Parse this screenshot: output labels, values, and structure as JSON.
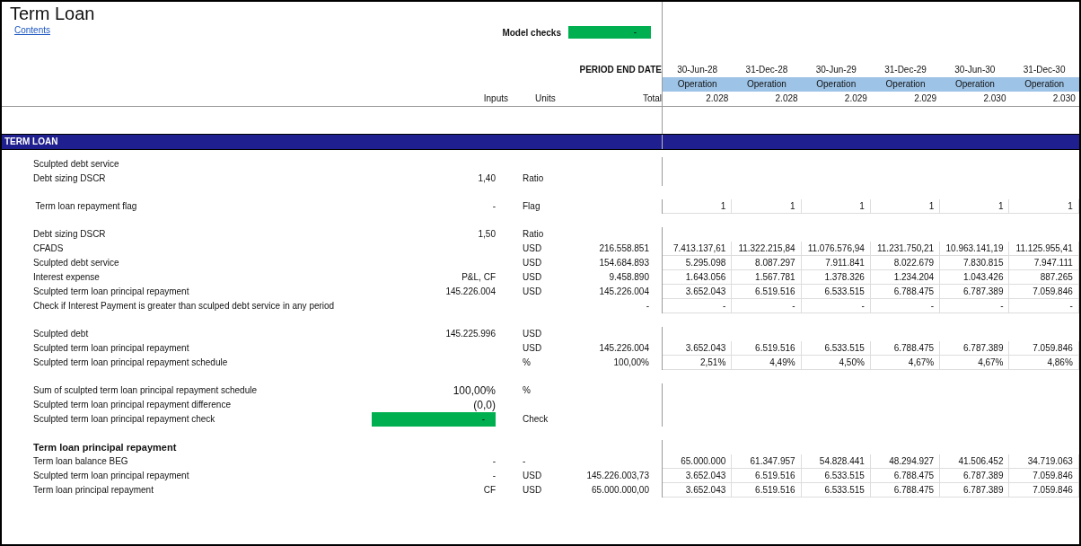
{
  "title": "Term Loan",
  "contents_link": "Contents",
  "model_checks": {
    "label": "Model checks",
    "value": "-",
    "passed": true
  },
  "columns": {
    "period_label": "PERIOD END DATE",
    "inputs": "Inputs",
    "units": "Units",
    "total": "Total"
  },
  "periods": [
    {
      "date": "30-Jun-28",
      "phase": "Operation",
      "year": "2.028"
    },
    {
      "date": "31-Dec-28",
      "phase": "Operation",
      "year": "2.028"
    },
    {
      "date": "30-Jun-29",
      "phase": "Operation",
      "year": "2.029"
    },
    {
      "date": "31-Dec-29",
      "phase": "Operation",
      "year": "2.029"
    },
    {
      "date": "30-Jun-30",
      "phase": "Operation",
      "year": "2.030"
    },
    {
      "date": "31-Dec-30",
      "phase": "Operation",
      "year": "2.030"
    }
  ],
  "section": "TERM LOAN",
  "groups": [
    {
      "rows": [
        {
          "kind": "line",
          "label": "Sculpted debt service"
        },
        {
          "kind": "line",
          "label": "Debt sizing DSCR",
          "inputs": "1,40",
          "units": "Ratio"
        }
      ]
    },
    {
      "rows": [
        {
          "kind": "line",
          "label": " Term loan repayment flag",
          "inputs": "-",
          "units": "Flag",
          "values": [
            "1",
            "1",
            "1",
            "1",
            "1",
            "1"
          ]
        }
      ]
    },
    {
      "rows": [
        {
          "kind": "line",
          "label": "Debt sizing DSCR",
          "inputs": "1,50",
          "units": "Ratio"
        },
        {
          "kind": "line",
          "label": "CFADS",
          "units": "USD",
          "total": "216.558.851",
          "values": [
            "7.413.137,61",
            "11.322.215,84",
            "11.076.576,94",
            "11.231.750,21",
            "10.963.141,19",
            "11.125.955,41"
          ]
        },
        {
          "kind": "line",
          "label": "Sculpted debt service",
          "units": "USD",
          "total": "154.684.893",
          "values": [
            "5.295.098",
            "8.087.297",
            "7.911.841",
            "8.022.679",
            "7.830.815",
            "7.947.111"
          ]
        },
        {
          "kind": "line",
          "label": "Interest expense",
          "inputs": "P&L, CF",
          "units": "USD",
          "total": "9.458.890",
          "values": [
            "1.643.056",
            "1.567.781",
            "1.378.326",
            "1.234.204",
            "1.043.426",
            "887.265"
          ]
        },
        {
          "kind": "line",
          "label": "Sculpted term loan principal repayment",
          "inputs": "145.226.004",
          "units": "USD",
          "total": "145.226.004",
          "values": [
            "3.652.043",
            "6.519.516",
            "6.533.515",
            "6.788.475",
            "6.787.389",
            "7.059.846"
          ]
        },
        {
          "kind": "line",
          "label": "Check if Interest Payment is greater than sculped debt service in any period",
          "total": "-",
          "values": [
            "-",
            "-",
            "-",
            "-",
            "-",
            "-"
          ]
        }
      ]
    },
    {
      "rows": [
        {
          "kind": "line",
          "label": "Sculpted debt",
          "inputs": "145.225.996",
          "units": "USD"
        },
        {
          "kind": "line",
          "label": "Sculpted term loan principal repayment",
          "units": "USD",
          "total": "145.226.004",
          "values": [
            "3.652.043",
            "6.519.516",
            "6.533.515",
            "6.788.475",
            "6.787.389",
            "7.059.846"
          ]
        },
        {
          "kind": "line",
          "label": "Sculpted term loan principal repayment schedule",
          "units": "%",
          "total": "100,00%",
          "values": [
            "2,51%",
            "4,49%",
            "4,50%",
            "4,67%",
            "4,67%",
            "4,86%"
          ]
        }
      ]
    },
    {
      "rows": [
        {
          "kind": "large",
          "label": "Sum of sculpted term loan principal repayment schedule",
          "inputs": "100,00%",
          "units": "%"
        },
        {
          "kind": "large",
          "label": "Sculpted term loan principal repayment difference",
          "inputs": "(0,0)"
        },
        {
          "kind": "check",
          "label": "Sculpted term loan principal repayment check",
          "inputs": "-",
          "passed": true,
          "units": "Check"
        }
      ]
    },
    {
      "rows": [
        {
          "kind": "heading",
          "label": "Term loan principal repayment"
        },
        {
          "kind": "line",
          "label": "Term loan balance BEG",
          "inputs": "-",
          "units": "-",
          "values": [
            "65.000.000",
            "61.347.957",
            "54.828.441",
            "48.294.927",
            "41.506.452",
            "34.719.063"
          ]
        },
        {
          "kind": "line",
          "label": "Sculpted term loan principal repayment",
          "inputs": "-",
          "units": "USD",
          "total": "145.226.003,73",
          "values": [
            "3.652.043",
            "6.519.516",
            "6.533.515",
            "6.788.475",
            "6.787.389",
            "7.059.846"
          ]
        },
        {
          "kind": "line",
          "label": "Term loan principal repayment",
          "inputs": "CF",
          "units": "USD",
          "total": "65.000.000,00",
          "values": [
            "3.652.043",
            "6.519.516",
            "6.533.515",
            "6.788.475",
            "6.787.389",
            "7.059.846"
          ]
        }
      ]
    }
  ]
}
